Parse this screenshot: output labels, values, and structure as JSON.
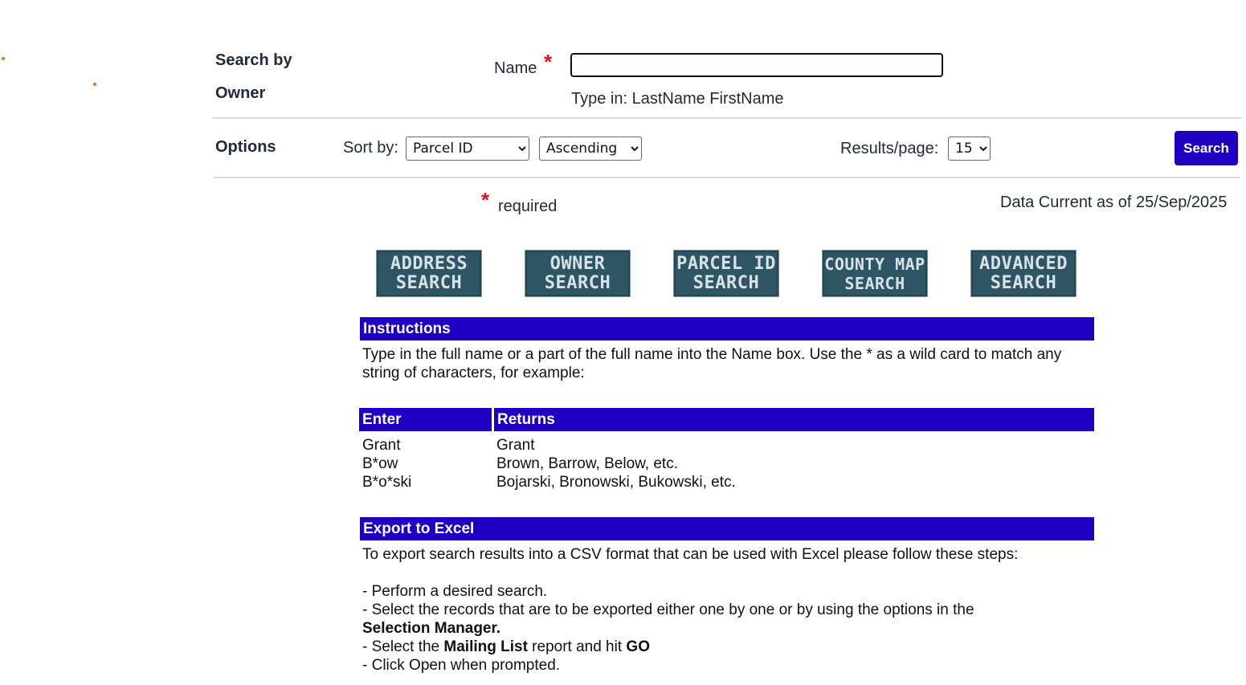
{
  "search_section": {
    "label_line1": "Search by",
    "label_line2": "Owner",
    "name_label": "Name",
    "required_star": "*",
    "name_value": "",
    "hint": "Type in: LastName FirstName"
  },
  "options": {
    "label": "Options",
    "sort_label": "Sort by:",
    "sort_field": "Parcel ID",
    "sort_order": "Ascending",
    "results_label": "Results/page:",
    "results_per_page": "15",
    "search_button": "Search"
  },
  "required_note": "required",
  "data_current": "Data Current as of 25/Sep/2025",
  "nav_buttons": [
    {
      "line1": "ADDRESS",
      "line2": "SEARCH"
    },
    {
      "line1": "OWNER",
      "line2": "SEARCH"
    },
    {
      "line1": "PARCEL ID",
      "line2": "SEARCH"
    },
    {
      "line1": "COUNTY MAP",
      "line2": "SEARCH"
    },
    {
      "line1": "ADVANCED",
      "line2": "SEARCH"
    }
  ],
  "instructions": {
    "header": "Instructions",
    "text": "Type in the full name or a part of the full name into the Name box. Use the * as a wild card to match any string of characters, for example:",
    "table": {
      "col_enter": "Enter",
      "col_returns": "Returns",
      "rows": [
        {
          "enter": "Grant",
          "returns": "Grant"
        },
        {
          "enter": "B*ow",
          "returns": "Brown, Barrow, Below, etc."
        },
        {
          "enter": "B*o*ski",
          "returns": "Bojarski, Bronowski, Bukowski, etc."
        }
      ]
    }
  },
  "export": {
    "header": "Export to Excel",
    "intro": "To export search results into a CSV format that can be used with Excel please follow these steps:",
    "step1": "- Perform a desired search.",
    "step2": "- Select the records that are to be exported either one by one or by using the options in the",
    "step2_bold": "Selection Manager.",
    "step3_pre": "- Select the ",
    "step3_bold1": "Mailing List",
    "step3_mid": " report and hit ",
    "step3_bold2": "GO",
    "step4": "- Click Open when prompted."
  },
  "colors": {
    "accent": "#1f00c2",
    "required": "#e0141e",
    "nav_button_bg": "#2e5563",
    "bullet": "#f26a22"
  }
}
